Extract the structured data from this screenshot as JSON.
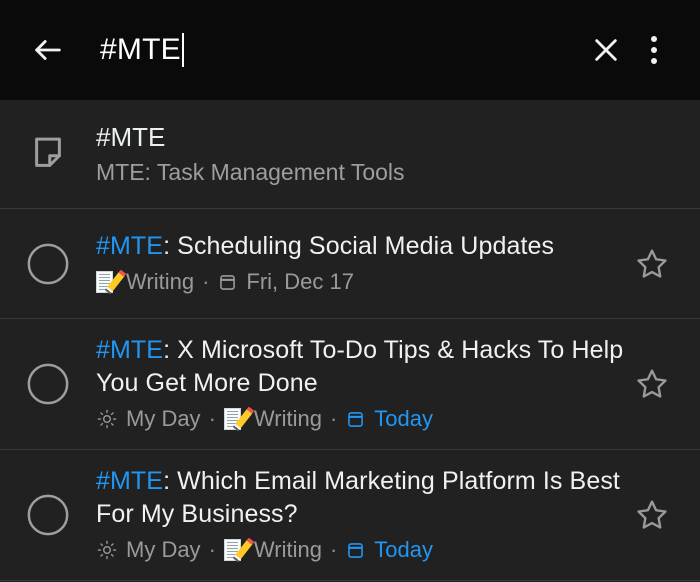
{
  "colors": {
    "accent": "#2196f3",
    "header_bg": "#0a0a0a",
    "body_bg": "#212121",
    "divider": "#3a3a3a",
    "primary_text": "#f1f1f1",
    "secondary_text": "#9a9a9a"
  },
  "header": {
    "back_icon": "arrow-back-icon",
    "search_value": "#MTE",
    "search_placeholder": "Search",
    "clear_icon": "close-icon",
    "overflow_icon": "more-vert-icon"
  },
  "suggestion": {
    "icon": "note-icon",
    "title": "#MTE",
    "subtitle": "MTE: Task Management Tools"
  },
  "tasks": [
    {
      "checkbox": "unchecked-circle-icon",
      "tag": "#MTE",
      "title": ": Scheduling Social Media Updates",
      "meta": [
        {
          "icon": "memo-emoji",
          "label": "Writing",
          "accent": false
        },
        {
          "icon": "calendar-icon",
          "label": "Fri, Dec 17",
          "accent": false
        }
      ],
      "star": "star-outline-icon",
      "starred": false
    },
    {
      "checkbox": "unchecked-circle-icon",
      "tag": "#MTE",
      "title": ": X Microsoft To-Do Tips & Hacks To Help You Get More Done",
      "meta": [
        {
          "icon": "sun-icon",
          "label": "My Day",
          "accent": false
        },
        {
          "icon": "memo-emoji",
          "label": "Writing",
          "accent": false
        },
        {
          "icon": "calendar-icon",
          "label": "Today",
          "accent": true
        }
      ],
      "star": "star-outline-icon",
      "starred": false
    },
    {
      "checkbox": "unchecked-circle-icon",
      "tag": "#MTE",
      "title": ": Which Email Marketing Platform Is Best For My Business?",
      "meta": [
        {
          "icon": "sun-icon",
          "label": "My Day",
          "accent": false
        },
        {
          "icon": "memo-emoji",
          "label": "Writing",
          "accent": false
        },
        {
          "icon": "calendar-icon",
          "label": "Today",
          "accent": true
        }
      ],
      "star": "star-outline-icon",
      "starred": false
    }
  ]
}
